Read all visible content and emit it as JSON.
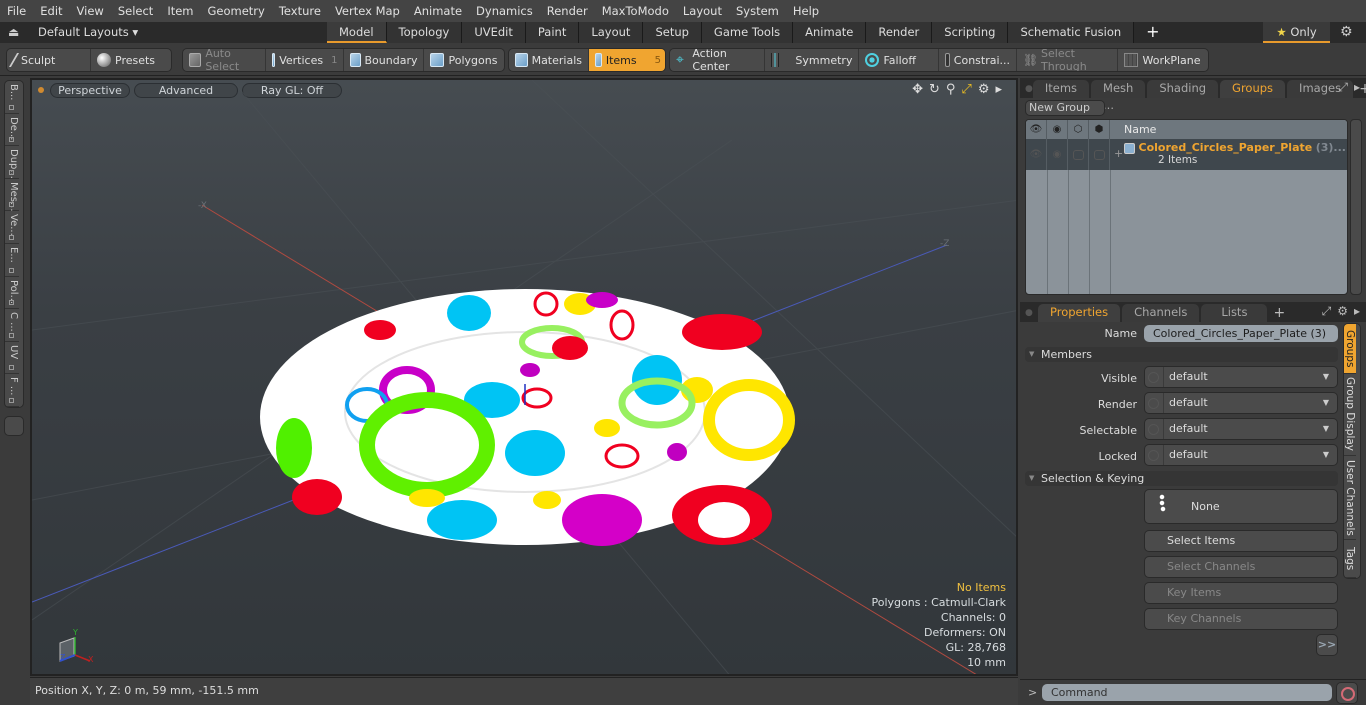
{
  "menu": [
    "File",
    "Edit",
    "View",
    "Select",
    "Item",
    "Geometry",
    "Texture",
    "Vertex Map",
    "Animate",
    "Dynamics",
    "Render",
    "MaxToModo",
    "Layout",
    "System",
    "Help"
  ],
  "layoutbar": {
    "layouts_dropdown": "Default Layouts ▾",
    "tabs": [
      "Model",
      "Topology",
      "UVEdit",
      "Paint",
      "Layout",
      "Setup",
      "Game Tools",
      "Animate",
      "Render",
      "Scripting",
      "Schematic Fusion"
    ],
    "active_tab": "Model",
    "only_label": "Only"
  },
  "toolbar": {
    "sculpt": "Sculpt",
    "presets": "Presets",
    "auto_select": "Auto Select",
    "vertices": "Vertices",
    "vertices_count": "1",
    "boundary": "Boundary",
    "polygons": "Polygons",
    "materials": "Materials",
    "items": "Items",
    "items_count": "5",
    "action_center": "Action Center",
    "symmetry": "Symmetry",
    "falloff": "Falloff",
    "constraints": "Constrai...",
    "select_through": "Select Through",
    "workplane": "WorkPlane"
  },
  "left_tabs": [
    "B...",
    "De...",
    "Dup...",
    "Mes...",
    "Ve...",
    "E...",
    "Pol...",
    "C ...",
    "UV",
    "F ..."
  ],
  "viewport": {
    "view_mode": "Perspective",
    "shading": "Advanced",
    "raygl": "Ray GL: Off",
    "info": {
      "selection": "No Items",
      "polygons": "Polygons : Catmull-Clark",
      "channels": "Channels: 0",
      "deformers": "Deformers: ON",
      "gl": "GL: 28,768",
      "scale": "10 mm"
    },
    "axis_labels": {
      "x": "X",
      "y": "Y",
      "z": "Z"
    }
  },
  "status": {
    "position": "Position X, Y, Z:   0 m, 59 mm, -151.5 mm"
  },
  "groups_panel": {
    "tabs": [
      "Items",
      "Mesh ...",
      "Shading",
      "Groups",
      "Images"
    ],
    "active_tab": "Groups",
    "new_group": "New Group",
    "column_name": "Name",
    "group": {
      "name": "Colored_Circles_Paper_Plate",
      "count": "(3)...",
      "sub": "2 Items"
    }
  },
  "properties_panel": {
    "tabs": [
      "Properties",
      "Channels",
      "Lists"
    ],
    "active_tab": "Properties",
    "name_label": "Name",
    "name_value": "Colored_Circles_Paper_Plate (3)",
    "members_section": "Members",
    "fields": [
      {
        "label": "Visible",
        "value": "default"
      },
      {
        "label": "Render",
        "value": "default"
      },
      {
        "label": "Selectable",
        "value": "default"
      },
      {
        "label": "Locked",
        "value": "default"
      }
    ],
    "selection_section": "Selection & Keying",
    "selection_mode": "None",
    "buttons": [
      {
        "label": "Select Items",
        "enabled": true
      },
      {
        "label": "Select Channels",
        "enabled": false
      },
      {
        "label": "Key Items",
        "enabled": false
      },
      {
        "label": "Key Channels",
        "enabled": false
      }
    ],
    "more": ">>",
    "side_tabs": [
      "Groups",
      "Group Display",
      "User Channels",
      "Tags"
    ],
    "active_side_tab": "Groups"
  },
  "command": {
    "prompt": ">",
    "placeholder": "Command"
  },
  "colors": {
    "accent": "#f0a530",
    "viewport_bg": "#3a3f44",
    "group_name": "#f0a530"
  }
}
